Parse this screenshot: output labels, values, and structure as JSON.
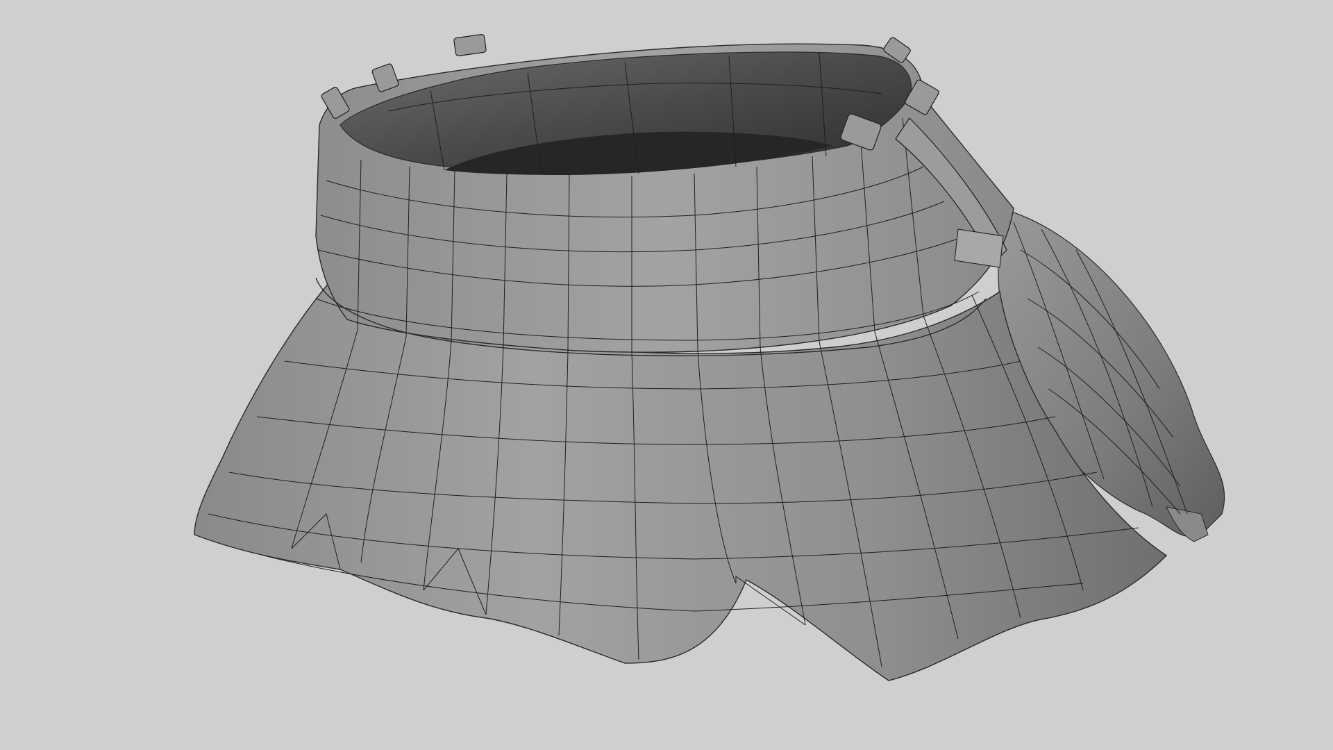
{
  "scene": {
    "subject": "skirt-mesh",
    "background_color": "#cfcfcf",
    "mesh_color": "#8c8c8c",
    "mesh_light_color": "#9e9e9e",
    "mesh_dark_color": "#5a5a5a",
    "interior_color": "#3a3a3a",
    "wire_color": "#1e1e1e"
  }
}
